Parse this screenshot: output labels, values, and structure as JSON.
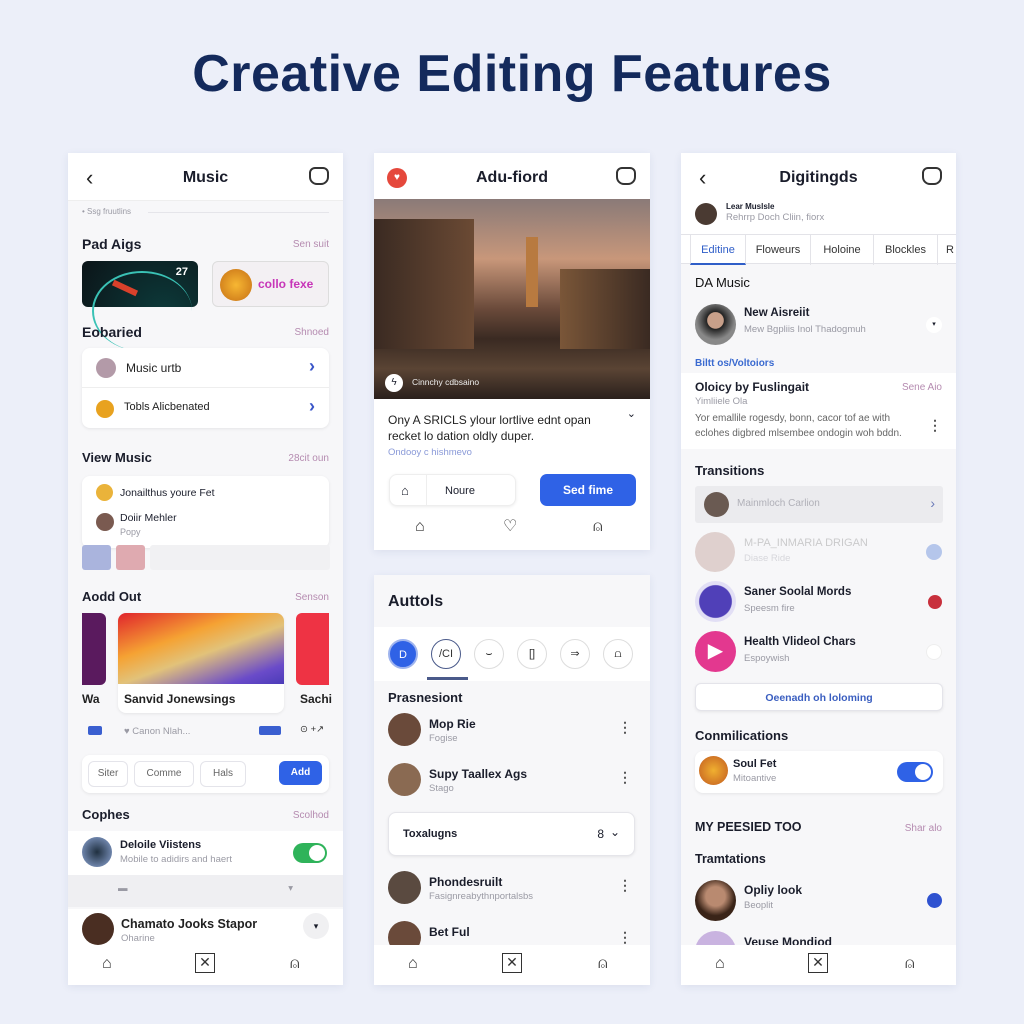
{
  "title": "Creative Editing Features",
  "colors": {
    "accent": "#2f62e6",
    "toggle_green": "#2fb35a",
    "heading": "#142a5c"
  },
  "left": {
    "header": {
      "title": "Music",
      "back_icon": "chevron-left",
      "right_icon": "mask-icon"
    },
    "hint": "• Ssg fruutlins",
    "pad": {
      "title": "Pad Aigs",
      "more": "Sen suit",
      "thumb1_value": "27",
      "thumb2_label": "collo fexe"
    },
    "eob": {
      "title": "Eobaried",
      "more": "Shnoed",
      "items": [
        "Music urtb",
        "Tobls Alicbenated"
      ]
    },
    "view": {
      "title": "View Music",
      "more": "28cit oun",
      "items": [
        {
          "title": "Jonailthus youre Fet"
        },
        {
          "title": "Doiir Mehler",
          "sub": "Popy"
        }
      ]
    },
    "add": {
      "title": "Aodd Out",
      "more": "Senson",
      "left_label": "Wa",
      "center_label": "Sanvid Jonewsings",
      "right_label": "Sachi",
      "meta": "Canon Nlah...",
      "buttons": [
        "Siter",
        "Comme",
        "Hals",
        "Add"
      ]
    },
    "cophes": {
      "title": "Cophes",
      "more": "Scolhod",
      "item": {
        "title": "Deloile Viistens",
        "sub": "Mobile to adidirs and haert",
        "toggle_on": true
      }
    },
    "bottom_item": {
      "title": "Chamato Jooks Stapor",
      "sub": "Oharine"
    }
  },
  "mid_top": {
    "header": {
      "title": "Adu-fiord"
    },
    "photo_caption": "Cinnchy cdbsaino",
    "text": "Ony A SRICLS ylour lortlive ednt opan recket lo dation oldly duper.",
    "link": "Ondooy c hishmevo",
    "input_value": "Noure",
    "primary": "Sed fime"
  },
  "mid_bottom": {
    "title": "Auttols",
    "tools": [
      "D",
      "/CI",
      "⌣",
      "[]",
      "⇒",
      "⩍"
    ],
    "section": "Prasnesiont",
    "items": [
      {
        "title": "Mop Rie",
        "sub": "Fogise"
      },
      {
        "title": "Supy Taallex Ags",
        "sub": "Stago"
      }
    ],
    "dropdown": {
      "label": "Toxalugns",
      "value": "8"
    },
    "items2": [
      {
        "title": "Phondesruilt",
        "sub": "Fasignreabythnportalsbs"
      },
      {
        "title": "Bet Ful"
      }
    ]
  },
  "right": {
    "header": {
      "title": "Digitingds"
    },
    "profile": {
      "name": "Lear Muslsle",
      "sub": "Rehrrp Doch Cliin, fiorx"
    },
    "tabs": [
      "Editine",
      "Floweurs",
      "Holoine",
      "Blockles",
      "R"
    ],
    "da": {
      "title": "DA Music",
      "item": {
        "title": "New Aisreiit",
        "sub": "Mew Bgpliis Inol Thadogmuh"
      },
      "link": "Biltt os/Voltoiors"
    },
    "card": {
      "title": "Oloicy by Fuslingait",
      "more": "Sene Aio",
      "sub": "Yimliiele Ola",
      "body": "Yor emallile rogesdy, bonn, cacor tof ae with eclohes digbred mlsembee ondogin woh bddn."
    },
    "transitions": {
      "title": "Transitions",
      "items": [
        {
          "title": "Mainmloch Carlion"
        },
        {
          "title": "M-PA_INMARIA DRIGAN",
          "sub": "Diase Ride"
        },
        {
          "title": "Saner Soolal Mords",
          "sub": "Speesm fire"
        },
        {
          "title": "Health Vlideol Chars",
          "sub": "Espoywish"
        }
      ],
      "button": "Oeenadh oh loloming"
    },
    "comm": {
      "title": "Conmilications",
      "item": {
        "title": "Soul Fet",
        "sub": "Mitoantive",
        "toggle_on": true
      }
    },
    "my": {
      "title": "MY PEESIED TOO",
      "more": "Shar alo"
    },
    "tram": {
      "title": "Tramtations",
      "items": [
        {
          "title": "Opliy look",
          "sub": "Beoplit"
        },
        {
          "title": "Veuse Mondiod"
        }
      ]
    }
  }
}
